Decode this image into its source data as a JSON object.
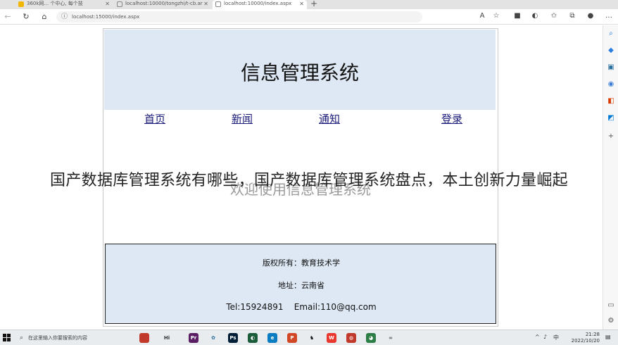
{
  "browser": {
    "tabs": [
      {
        "label": "360k网... 个中心, 每个技",
        "active": false,
        "color": "#f2b705"
      },
      {
        "label": "localhost:10000/tongzhi/t-cb.ar",
        "active": false,
        "color": "#888"
      },
      {
        "label": "localhost:10000/index.aspx",
        "active": true,
        "color": "#888"
      }
    ],
    "url": "localhost:15000/index.aspx"
  },
  "page": {
    "title": "信息管理系统",
    "menu": [
      "首页",
      "新闻",
      "通知",
      "登录"
    ],
    "welcome": "欢迎使用信息管理系统",
    "footer": {
      "copyright": "版权所有：教育技术学",
      "address": "地址：云南省",
      "contact": "Tel:15924891    Email:110@qq.com"
    }
  },
  "overlay_caption": "国产数据库管理系统有哪些，国产数据库管理系统盘点，本土创新力量崛起",
  "taskbar": {
    "search_placeholder": "在这里输入你要搜索的内容",
    "clock_time": "21:28",
    "clock_date": "2022/10/20"
  }
}
